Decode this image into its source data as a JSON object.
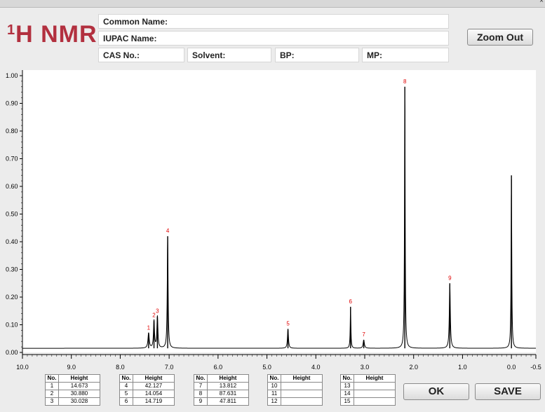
{
  "window": {
    "close_glyph": "×"
  },
  "logo": {
    "superscript": "1",
    "text": "H NMR"
  },
  "fields": {
    "common_name": "Common Name:",
    "iupac_name": "IUPAC Name:",
    "cas_no": "CAS No.:",
    "solvent": "Solvent:",
    "bp": "BP:",
    "mp": "MP:"
  },
  "buttons": {
    "zoom_out": "Zoom Out",
    "ok": "OK",
    "save": "SAVE"
  },
  "table": {
    "headers": [
      "No.",
      "Height"
    ],
    "rows": [
      [
        "1",
        "14.673"
      ],
      [
        "2",
        "30.880"
      ],
      [
        "3",
        "30.028"
      ],
      [
        "4",
        "42.127"
      ],
      [
        "5",
        "14.054"
      ],
      [
        "6",
        "14.719"
      ],
      [
        "7",
        "13.812"
      ],
      [
        "8",
        "87.631"
      ],
      [
        "9",
        "47.811"
      ],
      [
        "10",
        ""
      ],
      [
        "11",
        ""
      ],
      [
        "12",
        ""
      ],
      [
        "13",
        ""
      ],
      [
        "14",
        ""
      ],
      [
        "15",
        ""
      ]
    ]
  },
  "chart_data": {
    "type": "line",
    "xlim": [
      10.0,
      -0.5
    ],
    "ylim": [
      0.0,
      1.0
    ],
    "x_ticks": [
      "10.0",
      "9.0",
      "8.0",
      "7.0",
      "6.0",
      "5.0",
      "4.0",
      "3.0",
      "2.0",
      "1.0",
      "0.0",
      "-0.5"
    ],
    "y_ticks": [
      "0.00",
      "0.10",
      "0.20",
      "0.30",
      "0.40",
      "0.50",
      "0.60",
      "0.70",
      "0.80",
      "0.90",
      "1.00"
    ],
    "baseline": 0.015,
    "peaks": [
      {
        "label": "1",
        "ppm": 7.42,
        "height": 0.07,
        "width": 0.015
      },
      {
        "label": "2",
        "ppm": 7.31,
        "height": 0.115,
        "width": 0.012
      },
      {
        "label": "3",
        "ppm": 7.24,
        "height": 0.13,
        "width": 0.012
      },
      {
        "label": "4",
        "ppm": 7.03,
        "height": 0.42,
        "width": 0.01
      },
      {
        "label": "5",
        "ppm": 4.57,
        "height": 0.085,
        "width": 0.012
      },
      {
        "label": "6",
        "ppm": 3.29,
        "height": 0.165,
        "width": 0.008
      },
      {
        "label": "7",
        "ppm": 3.02,
        "height": 0.045,
        "width": 0.015
      },
      {
        "label": "8",
        "ppm": 2.18,
        "height": 0.96,
        "width": 0.008
      },
      {
        "label": "9",
        "ppm": 1.26,
        "height": 0.25,
        "width": 0.012
      },
      {
        "label": "",
        "ppm": 0.0,
        "height": 0.64,
        "width": 0.008
      }
    ],
    "colors": {
      "trace": "#000000",
      "peak_label": "#e00000",
      "axis": "#000000"
    }
  }
}
